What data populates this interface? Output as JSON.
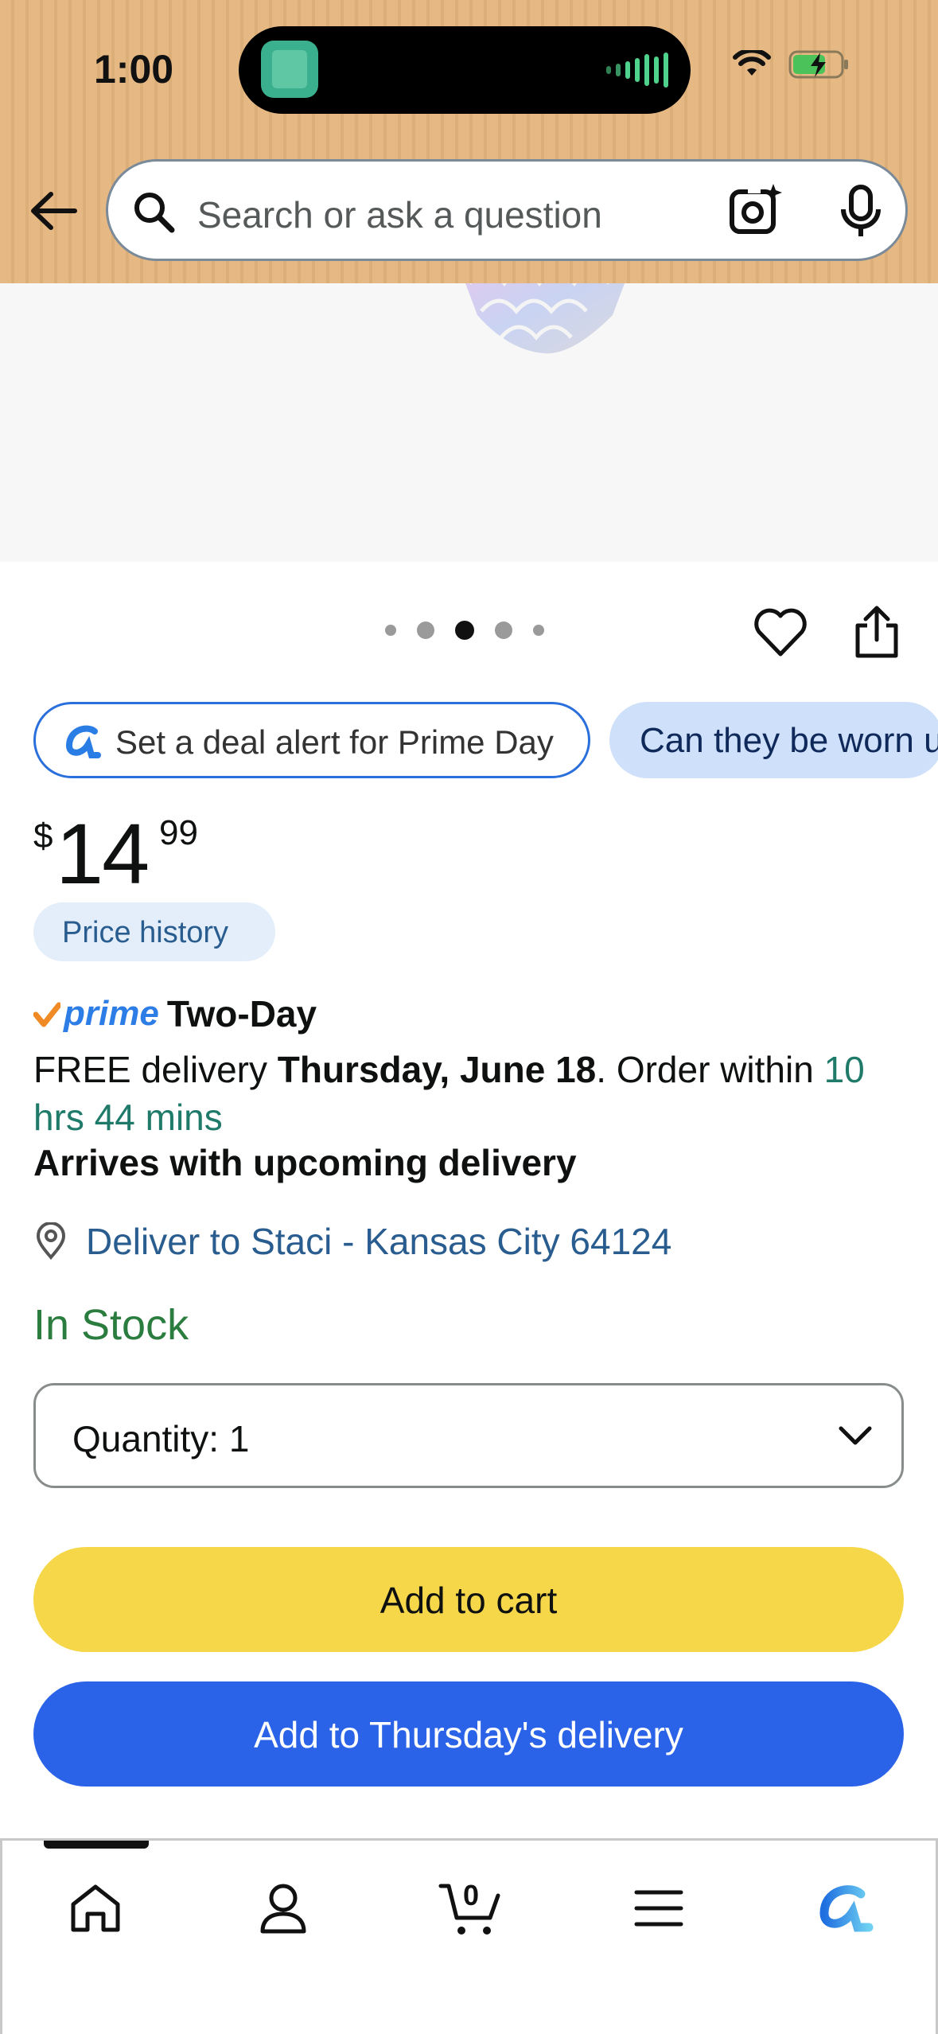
{
  "status_bar": {
    "time": "1:00"
  },
  "search": {
    "placeholder": "Search or ask a question"
  },
  "gallery": {
    "image_count": 5,
    "active_index": 2
  },
  "chips": {
    "deal_alert": "Set a deal alert for Prime Day",
    "question": "Can they be worn u"
  },
  "price": {
    "symbol": "$",
    "whole": "14",
    "fraction": "99",
    "history_label": "Price history"
  },
  "delivery": {
    "prime_label": "prime",
    "prime_type": "Two-Day",
    "free_prefix": "FREE delivery ",
    "date": "Thursday, June 18",
    "order_within": ". Order within ",
    "countdown": "10 hrs 44 mins",
    "arrives": "Arrives with upcoming delivery",
    "deliver_to": "Deliver to Staci - Kansas City 64124"
  },
  "stock": {
    "status": "In Stock"
  },
  "quantity": {
    "label": "Quantity:",
    "value": "1"
  },
  "buttons": {
    "add_to_cart": "Add to cart",
    "add_to_delivery": "Add to Thursday's delivery"
  },
  "nav": {
    "items": [
      "home-icon",
      "account-icon",
      "cart-icon",
      "menu-icon",
      "rufus-icon"
    ],
    "cart_count": "0"
  },
  "colors": {
    "header": "#e6b883",
    "add_to_cart": "#f5d749",
    "add_to_delivery": "#2b63e8",
    "in_stock": "#2b7d3f",
    "link": "#2a5d8f"
  }
}
